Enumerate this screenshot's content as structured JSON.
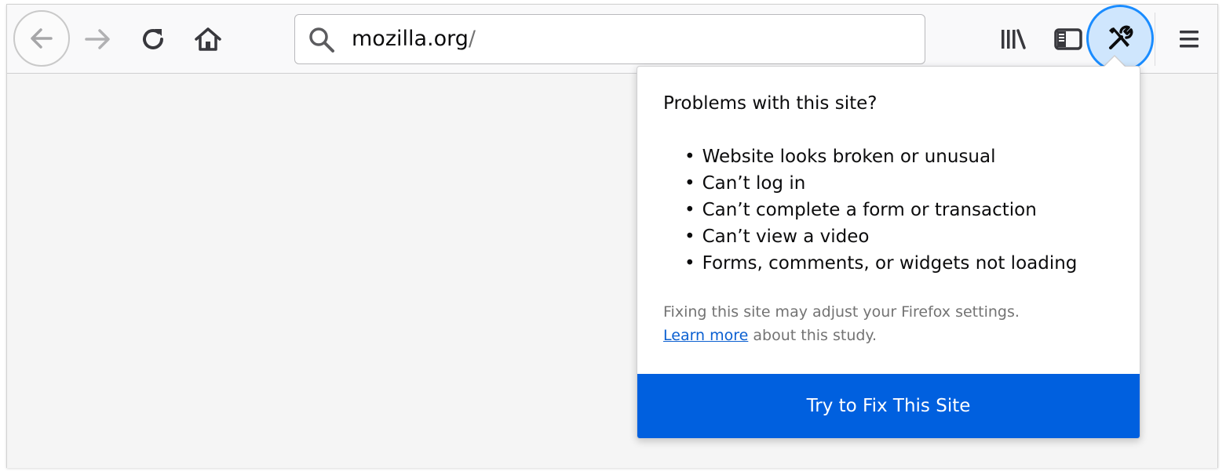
{
  "toolbar": {
    "url": "mozilla.org",
    "url_suffix": "/",
    "icons": {
      "back": "back-arrow-icon",
      "forward": "forward-arrow-icon",
      "reload": "reload-icon",
      "home": "home-icon",
      "search": "search-icon",
      "library": "library-icon",
      "sidebar": "sidebar-icon",
      "tools": "tools-icon",
      "menu": "hamburger-menu-icon"
    }
  },
  "popup": {
    "title": "Problems with this site?",
    "items": [
      "Website looks broken or unusual",
      "Can’t log in",
      "Can’t complete a form or transaction",
      "Can’t view a video",
      "Forms, comments, or widgets not loading"
    ],
    "note_line1": "Fixing this site may adjust your Firefox settings.",
    "learn_more": "Learn more",
    "note_line2_rest": " about this study.",
    "button_label": "Try to Fix This Site"
  },
  "colors": {
    "accent": "#0060df",
    "highlight_ring": "#1a8cff",
    "highlight_fill": "#cfe6fd",
    "link": "#0a5fd1"
  }
}
